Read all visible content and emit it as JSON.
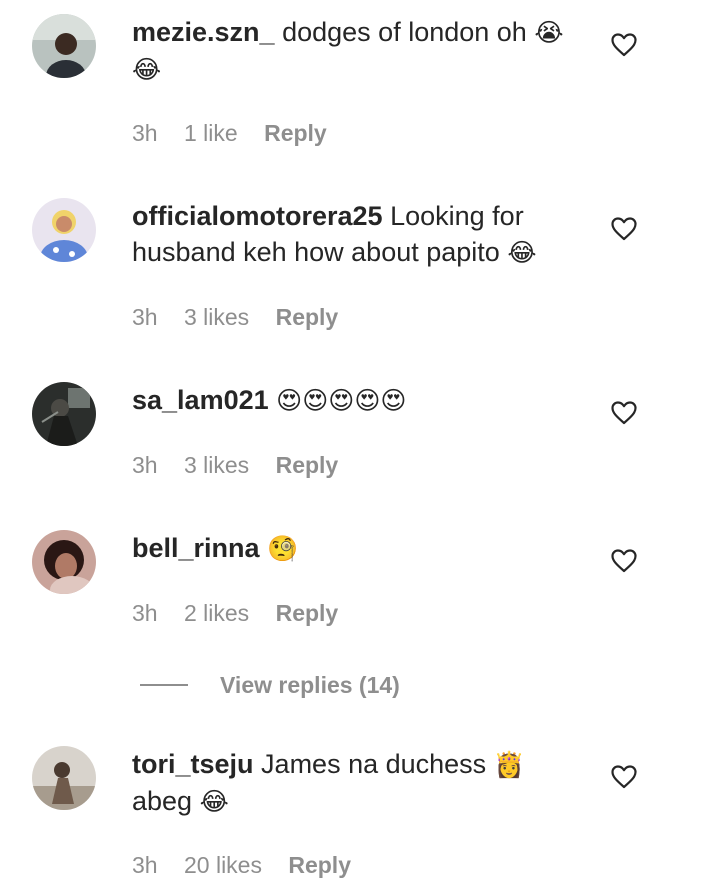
{
  "comments": [
    {
      "username": "mezie.szn_",
      "text": "dodges of london oh",
      "emojis": "😭 😂",
      "time": "3h",
      "likes": "1 like",
      "reply_label": "Reply"
    },
    {
      "username": "officialomotorera25",
      "text": "Looking for husband keh how about papito",
      "emojis": "😂",
      "time": "3h",
      "likes": "3 likes",
      "reply_label": "Reply"
    },
    {
      "username": "sa_lam021",
      "text": "",
      "emojis": "😍😍😍😍😍",
      "time": "3h",
      "likes": "3 likes",
      "reply_label": "Reply"
    },
    {
      "username": "bell_rinna",
      "text": "",
      "emojis": "🧐",
      "time": "3h",
      "likes": "2 likes",
      "reply_label": "Reply"
    },
    {
      "username": "tori_tseju",
      "text": "James na duchess",
      "emojis": "👸",
      "text2": "abeg",
      "emojis2": "😂",
      "time": "3h",
      "likes": "20 likes",
      "reply_label": "Reply"
    }
  ],
  "view_replies": "View replies (14)",
  "colors": {
    "text": "#262626",
    "muted": "#8e8e8e",
    "background": "#ffffff"
  }
}
